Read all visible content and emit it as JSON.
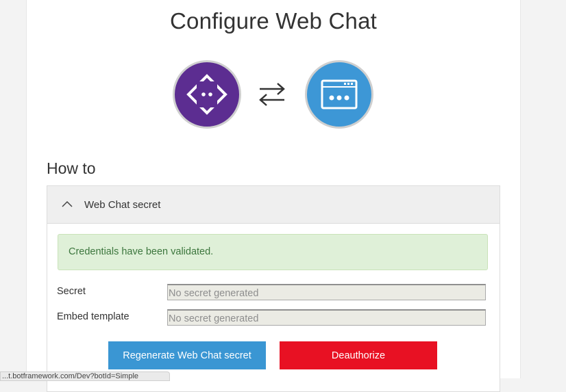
{
  "page": {
    "title": "Configure Web Chat",
    "section_heading": "How to"
  },
  "hero": {
    "left_icon": "bot-code-icon",
    "middle_icon": "swap-arrows-icon",
    "right_icon": "browser-window-icon",
    "left_color": "#5c2d91",
    "right_color": "#3d97d6"
  },
  "accordion": {
    "title": "Web Chat secret",
    "expanded": true,
    "chevron_icon": "chevron-up-icon"
  },
  "alert": {
    "message": "Credentials have been validated.",
    "status_color": "#dff0d8"
  },
  "form": {
    "secret_label": "Secret",
    "secret_placeholder": "No secret generated",
    "embed_label": "Embed template",
    "embed_placeholder": "No secret generated"
  },
  "buttons": {
    "regenerate_label": "Regenerate Web Chat secret",
    "deauthorize_label": "Deauthorize",
    "regenerate_color": "#3a96d3",
    "deauthorize_color": "#e81123"
  },
  "status_bar": {
    "text": "...t.botframework.com/Dev?botId=Simple"
  }
}
